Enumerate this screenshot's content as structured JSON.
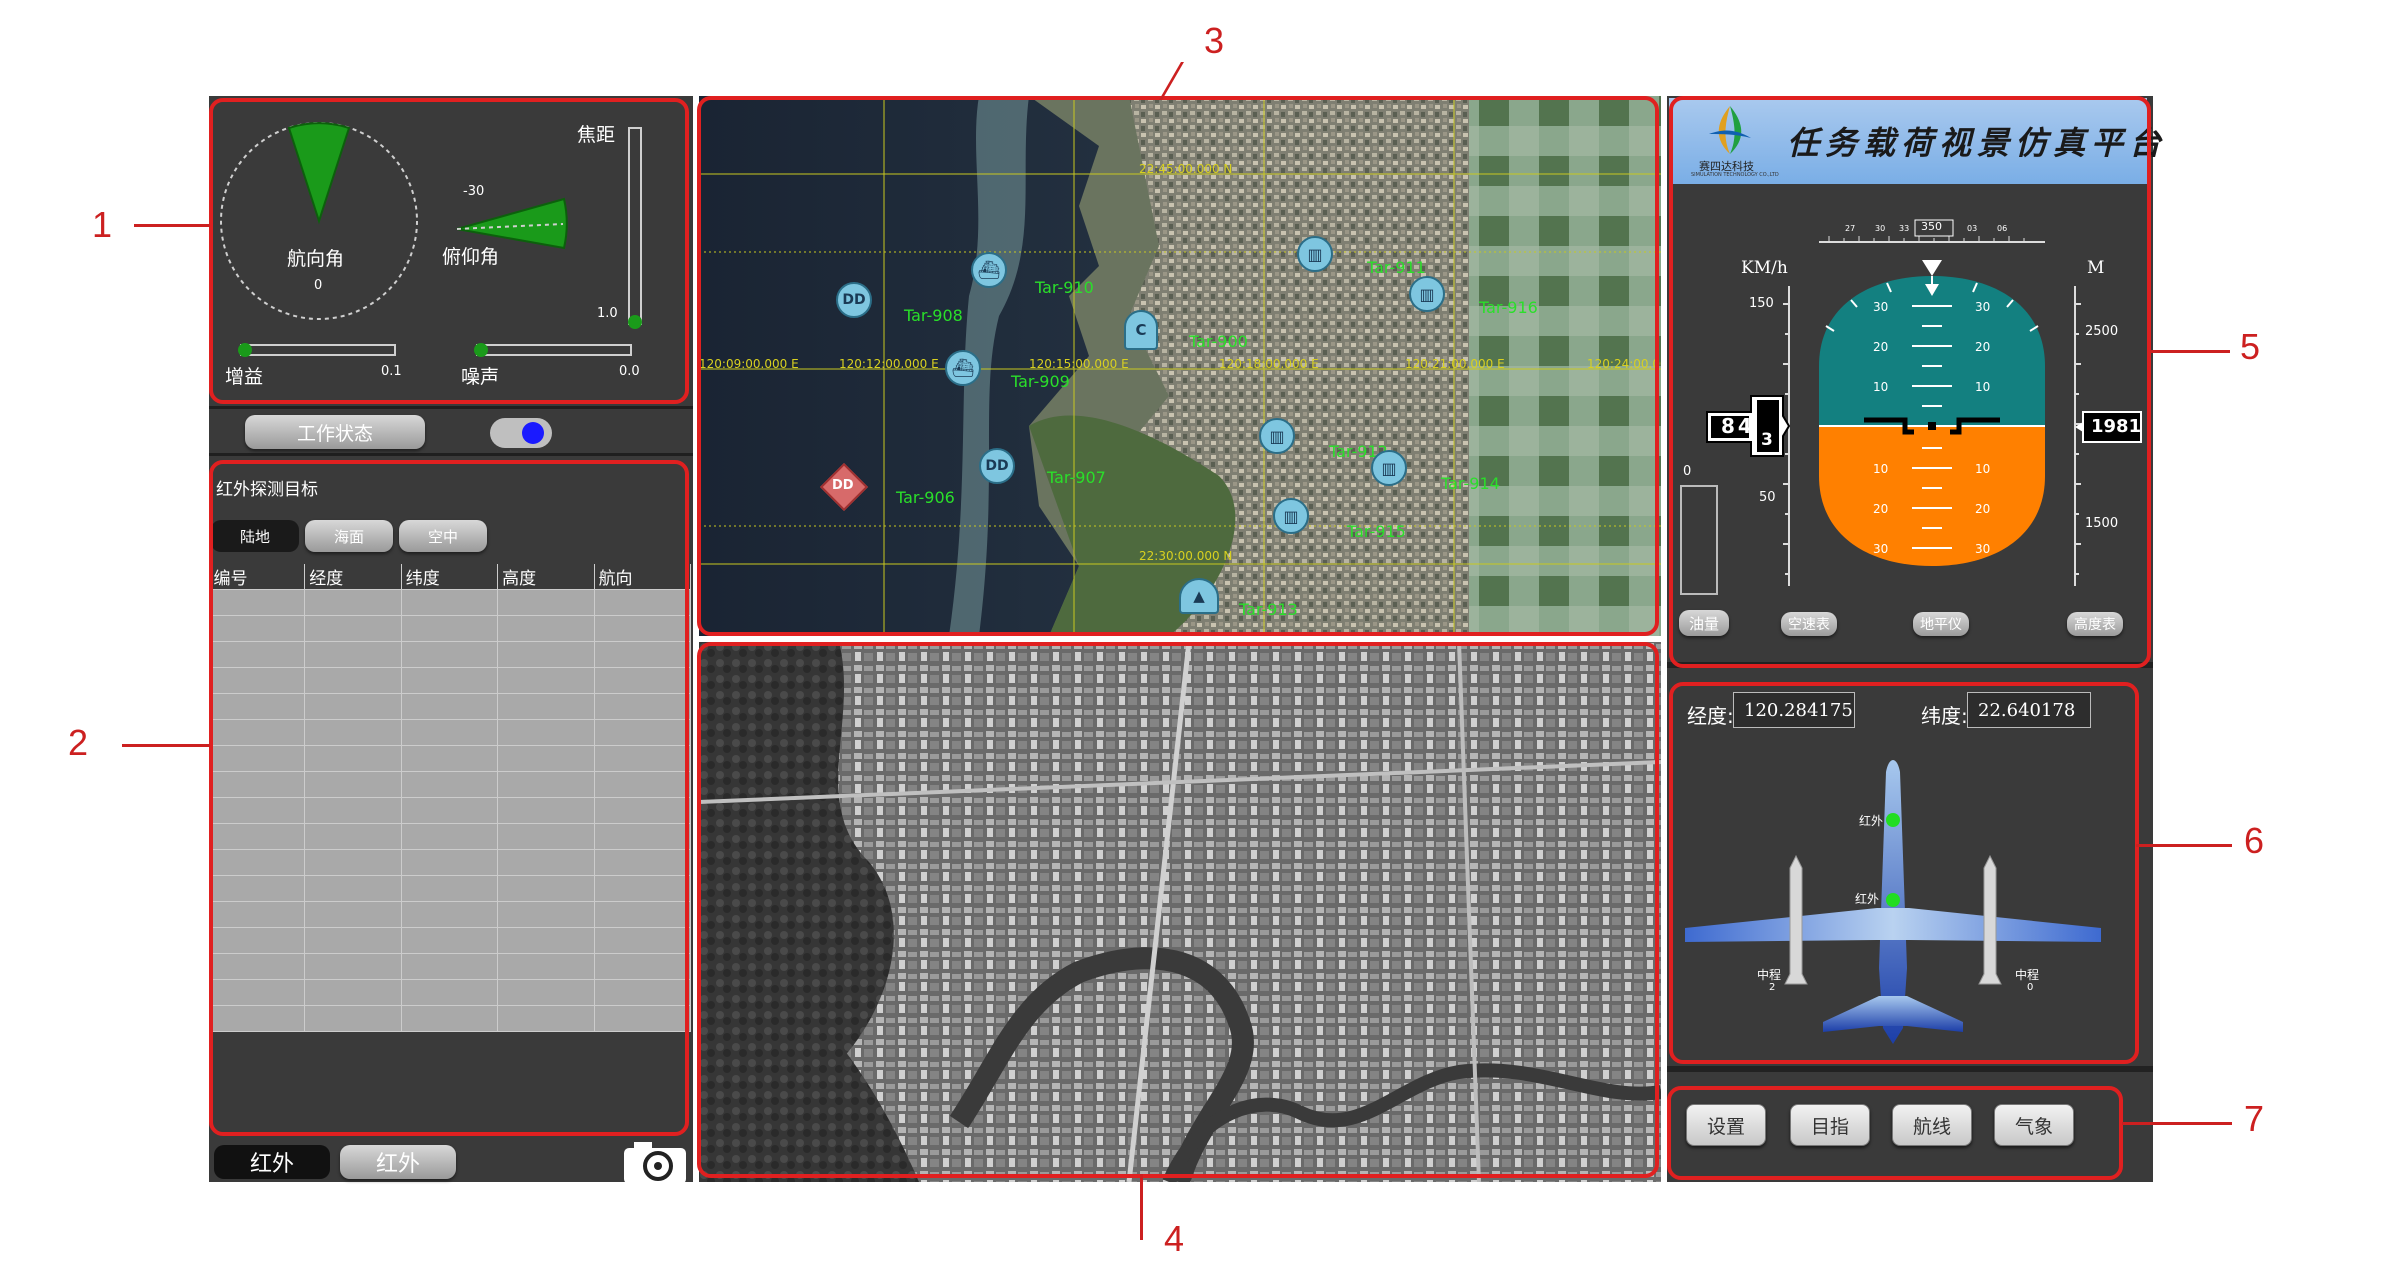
{
  "callouts": [
    "1",
    "2",
    "3",
    "4",
    "5",
    "6",
    "7"
  ],
  "sensor": {
    "heading_label": "航向角",
    "heading_value": "0",
    "pitch_label": "俯仰角",
    "pitch_value": "-30",
    "focal_label": "焦距",
    "focal_value": "1.0",
    "gain_label": "增益",
    "gain_value": "0.1",
    "noise_label": "噪声",
    "noise_value": "0.0",
    "accent_color": "#1a9a1a"
  },
  "status": {
    "work_status_label": "工作状态",
    "indicator_color": "#1a1aff"
  },
  "targets": {
    "title": "红外探测目标",
    "filters": [
      "陆地",
      "海面",
      "空中"
    ],
    "active_filter": "陆地",
    "columns": [
      "编号",
      "经度",
      "纬度",
      "高度",
      "航向"
    ],
    "row_count": 17
  },
  "bottom_tabs": [
    "红外",
    "红外"
  ],
  "camera_icon": "camera-icon",
  "map": {
    "lat_labels": [
      "22:45:00.000 N",
      "22:30:00.000 N"
    ],
    "lon_labels": [
      "120:12:00.000 E",
      "120:15:00.000 E",
      "120:18:00.000 E",
      "120:21:00.000 E",
      "120:24:00.000 E",
      "120:09:00.000 E"
    ],
    "targets": [
      {
        "id": "Tar-908",
        "marker": "DD"
      },
      {
        "id": "Tar-909",
        "marker": "ship"
      },
      {
        "id": "Tar-910",
        "marker": "ship"
      },
      {
        "id": "Tar-906",
        "marker": "DD"
      },
      {
        "id": "Tar-907",
        "marker": "DD"
      },
      {
        "id": "Tar-916",
        "marker": "building"
      },
      {
        "id": "Tar-911",
        "marker": "building"
      },
      {
        "id": "Tar-912",
        "marker": "building"
      },
      {
        "id": "Tar-914",
        "marker": "building"
      },
      {
        "id": "Tar-915",
        "marker": "building"
      },
      {
        "id": "Tar-913",
        "marker": "building"
      },
      {
        "id": "Tar-900",
        "marker": "C"
      }
    ],
    "sea_color": "#1e2a3a",
    "grid_color": "#c8c820",
    "label_color": "#2adf2a"
  },
  "platform": {
    "company": "赛四达科技",
    "company_en": "SIMULATION TECHNOLOGY CO.,LTD",
    "title": "任务载荷视景仿真平台"
  },
  "pfd": {
    "speed_unit": "KM/h",
    "alt_unit": "M",
    "heading_value": "350",
    "heading_ticks": [
      "27",
      "30",
      "33",
      "03",
      "06"
    ],
    "speed_ticks": [
      "150",
      "100",
      "50"
    ],
    "speed_value": "84",
    "speed_sub": "3",
    "alt_ticks": [
      "2500",
      "2000",
      "1500"
    ],
    "alt_value": "1981",
    "fuel_value": "0",
    "pitch_marks": [
      "30",
      "20",
      "10",
      "10",
      "20",
      "30"
    ],
    "sky_color": "#138080",
    "ground_color": "#ff8000",
    "labels": [
      "油量",
      "空速表",
      "地平仪",
      "高度表"
    ]
  },
  "stores": {
    "lon_label": "经度:",
    "lon_value": "120.284175",
    "lat_label": "纬度:",
    "lat_value": "22.640178",
    "store_labels": [
      "红外",
      "红外"
    ],
    "missile_left": {
      "label": "中程",
      "count": "2"
    },
    "missile_right": {
      "label": "中程",
      "count": "0"
    },
    "station_color": "#22dd22"
  },
  "actions": [
    "设置",
    "目指",
    "航线",
    "气象"
  ]
}
